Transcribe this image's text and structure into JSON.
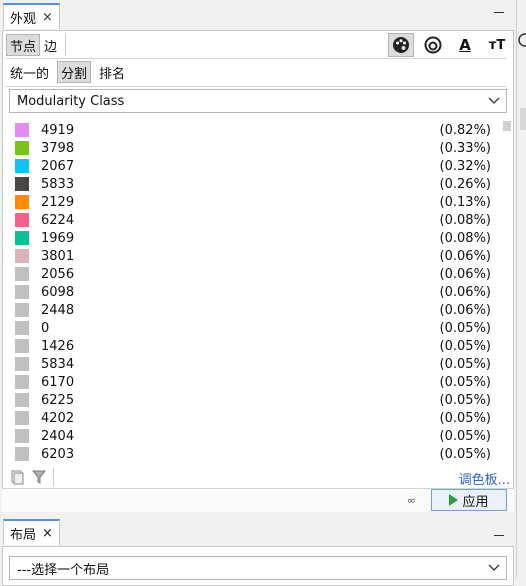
{
  "appearance_tab": {
    "label": "外观",
    "close": "×"
  },
  "node_edge_tabs": [
    {
      "label": "节点",
      "active": true
    },
    {
      "label": "边",
      "active": false
    }
  ],
  "mode_tabs": [
    {
      "label": "统一的",
      "active": false
    },
    {
      "label": "分割",
      "active": true
    },
    {
      "label": "排名",
      "active": false
    }
  ],
  "tools": {
    "color_icon": "palette-icon",
    "size_icon": "size-icon",
    "label_color": "A",
    "label_size": "тТ"
  },
  "attribute_select": {
    "value": "Modularity Class"
  },
  "partitions": [
    {
      "id": "4919",
      "pct": "(0.82%)",
      "color": "#e38cf0"
    },
    {
      "id": "3798",
      "pct": "(0.33%)",
      "color": "#7cc21a"
    },
    {
      "id": "2067",
      "pct": "(0.32%)",
      "color": "#14c3f5"
    },
    {
      "id": "5833",
      "pct": "(0.26%)",
      "color": "#4a4641"
    },
    {
      "id": "2129",
      "pct": "(0.13%)",
      "color": "#ff8c00"
    },
    {
      "id": "6224",
      "pct": "(0.08%)",
      "color": "#f45f8e"
    },
    {
      "id": "1969",
      "pct": "(0.08%)",
      "color": "#0fbf96"
    },
    {
      "id": "3801",
      "pct": "(0.06%)",
      "color": "#d9b4b4"
    },
    {
      "id": "2056",
      "pct": "(0.06%)",
      "color": "#c0c0c0"
    },
    {
      "id": "6098",
      "pct": "(0.06%)",
      "color": "#c0c0c0"
    },
    {
      "id": "2448",
      "pct": "(0.06%)",
      "color": "#c0c0c0"
    },
    {
      "id": "0",
      "pct": "(0.05%)",
      "color": "#c0c0c0"
    },
    {
      "id": "1426",
      "pct": "(0.05%)",
      "color": "#c0c0c0"
    },
    {
      "id": "5834",
      "pct": "(0.05%)",
      "color": "#c0c0c0"
    },
    {
      "id": "6170",
      "pct": "(0.05%)",
      "color": "#c0c0c0"
    },
    {
      "id": "6225",
      "pct": "(0.05%)",
      "color": "#c0c0c0"
    },
    {
      "id": "4202",
      "pct": "(0.05%)",
      "color": "#c0c0c0"
    },
    {
      "id": "2404",
      "pct": "(0.05%)",
      "color": "#c0c0c0"
    },
    {
      "id": "6203",
      "pct": "(0.05%)",
      "color": "#c0c0c0"
    }
  ],
  "palette_link": "调色板...",
  "apply_button": "应用",
  "layout_tab": {
    "label": "布局",
    "close": "×"
  },
  "layout_select": {
    "value": "---选择一个布局"
  }
}
